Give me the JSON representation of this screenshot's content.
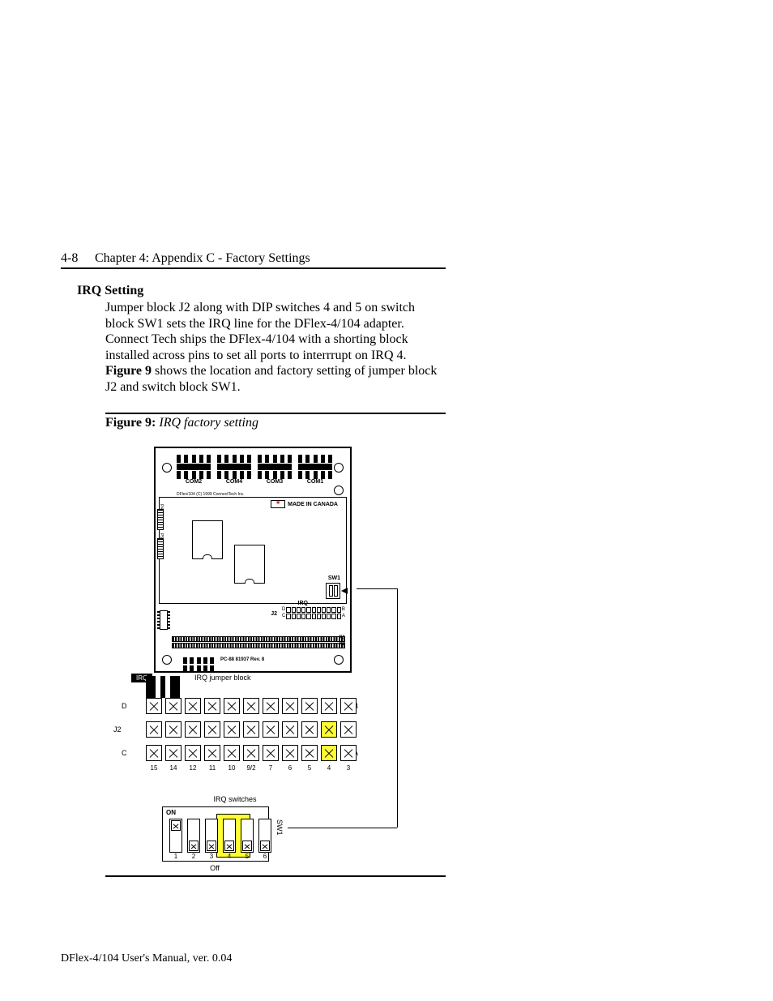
{
  "header": {
    "page_number": "4-8",
    "chapter_title": "Chapter 4: Appendix C - Factory Settings"
  },
  "section": {
    "title": "IRQ Setting",
    "body_parts": [
      "Jumper block J2 along with DIP switches 4 and 5 on switch block SW1 sets the IRQ line for the DFlex-4/104 adapter.  Connect Tech ships the DFlex-4/104 with a shorting block installed across pins to set all ports to interrrupt on IRQ 4.  ",
      "Figure 9",
      " shows the location and factory setting of jumper block J2 and switch block SW1."
    ]
  },
  "figure": {
    "number": "Figure 9:",
    "title": "IRQ factory setting"
  },
  "board": {
    "com_labels": [
      "COM2",
      "COM4",
      "COM3",
      "COM1"
    ],
    "copyright": "DFlex/104 (C) 1999 ConnectTech Inc.",
    "made_in": "MADE IN CANADA",
    "flag_glyph": "✳",
    "side_labels": [
      "P4",
      "P5"
    ],
    "sw1_label": "SW1",
    "irq_label": "IRQ",
    "j2_label": "J2",
    "j2_row_letters": [
      "D",
      "C",
      "A"
    ],
    "j2_side_B": "B",
    "j2_numbers": [
      "15",
      "14",
      "12",
      "11",
      "10",
      "9",
      "7",
      "6",
      "5",
      "4",
      "3"
    ],
    "bus_labels": [
      "P1",
      "P2"
    ],
    "rev": "PC-88 81937      Rev. 8"
  },
  "j2_detail": {
    "title": "IRQ jumper block",
    "badge": "IRQ",
    "side_label": "J2",
    "row_left": [
      "D",
      "",
      "C"
    ],
    "row_right": [
      "B",
      "",
      "A"
    ],
    "numbers": [
      "15",
      "14",
      "12",
      "11",
      "10",
      "9/2",
      "7",
      "6",
      "5",
      "4",
      "3"
    ],
    "highlighted_col_index": 9
  },
  "sw1_detail": {
    "title": "IRQ switches",
    "on_label": "ON",
    "off_label": "Off",
    "side_label": "SW1",
    "switch_numbers": [
      "1",
      "2",
      "3",
      "4",
      "5",
      "6"
    ],
    "positions": [
      "up",
      "dn",
      "dn",
      "dn",
      "dn",
      "dn"
    ],
    "highlighted": [
      3,
      4
    ]
  },
  "footer": "DFlex-4/104 User's Manual, ver. 0.04"
}
